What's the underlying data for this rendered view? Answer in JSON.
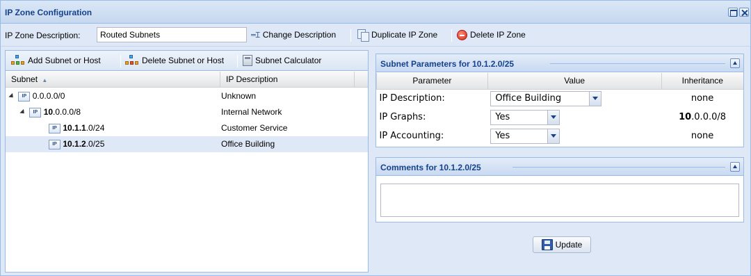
{
  "window": {
    "title": "IP Zone Configuration"
  },
  "toolbar": {
    "description_label": "IP Zone Description:",
    "description_value": "Routed Subnets",
    "change_description": "Change Description",
    "duplicate_zone": "Duplicate IP Zone",
    "delete_zone": "Delete IP Zone"
  },
  "left_toolbar": {
    "add": "Add Subnet or Host",
    "delete": "Delete Subnet or Host",
    "calculator": "Subnet Calculator"
  },
  "grid": {
    "col_subnet": "Subnet",
    "col_description": "IP Description",
    "rows": [
      {
        "bold": "",
        "rest": "0.0.0.0/0",
        "description": "Unknown",
        "expanded": true
      },
      {
        "bold": "10",
        "rest": ".0.0.0/8",
        "description": "Internal Network",
        "expanded": true
      },
      {
        "bold": "10.1.1",
        "rest": ".0/24",
        "description": "Customer Service",
        "expanded": false
      },
      {
        "bold": "10.1.2",
        "rest": ".0/25",
        "description": "Office Building",
        "expanded": false,
        "selected": true
      }
    ]
  },
  "subnet_params": {
    "title": "Subnet Parameters for 10.1.2.0/25",
    "headers": {
      "parameter": "Parameter",
      "value": "Value",
      "inheritance": "Inheritance"
    },
    "rows": [
      {
        "name": "IP Description:",
        "value": "Office Building",
        "inherit_bold": "",
        "inherit_rest": "none"
      },
      {
        "name": "IP Graphs:",
        "value": "Yes",
        "inherit_bold": "10",
        "inherit_rest": ".0.0.0/8"
      },
      {
        "name": "IP Accounting:",
        "value": "Yes",
        "inherit_bold": "",
        "inherit_rest": "none"
      }
    ]
  },
  "comments": {
    "title": "Comments for 10.1.2.0/25",
    "value": ""
  },
  "update_button": "Update",
  "icons": {
    "ip": "IP",
    "colors": {
      "accent": "#15428b",
      "border": "#99bbe8",
      "selected_row": "#dfe8f6"
    }
  }
}
